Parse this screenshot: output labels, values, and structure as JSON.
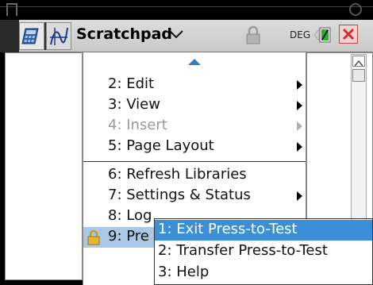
{
  "toolbar": {
    "title": "Scratchpad",
    "angle_mode": "DEG"
  },
  "menu": {
    "items": [
      {
        "label": "2: Edit",
        "has_submenu": true,
        "enabled": true
      },
      {
        "label": "3: View",
        "has_submenu": true,
        "enabled": true
      },
      {
        "label": "4: Insert",
        "has_submenu": true,
        "enabled": false
      },
      {
        "label": "5: Page Layout",
        "has_submenu": true,
        "enabled": true
      },
      {
        "label": "6: Refresh Libraries",
        "has_submenu": false,
        "enabled": true
      },
      {
        "label": "7: Settings & Status",
        "has_submenu": true,
        "enabled": true
      },
      {
        "label": "8: Log",
        "has_submenu": false,
        "enabled": true
      },
      {
        "label": "9: Pre",
        "has_submenu": true,
        "enabled": true,
        "selected": true
      }
    ]
  },
  "submenu": {
    "items": [
      {
        "label": "1: Exit Press-to-Test",
        "selected": true
      },
      {
        "label": "2: Transfer Press-to-Test",
        "selected": false
      },
      {
        "label": "3: Help",
        "selected": false
      }
    ]
  },
  "colors": {
    "selected_highlight": "#3a8fd6",
    "parent_highlight": "#a9c8e6",
    "disabled_text": "#9a9a9a",
    "close_red": "#c83030",
    "battery_green": "#2eaa2e"
  }
}
